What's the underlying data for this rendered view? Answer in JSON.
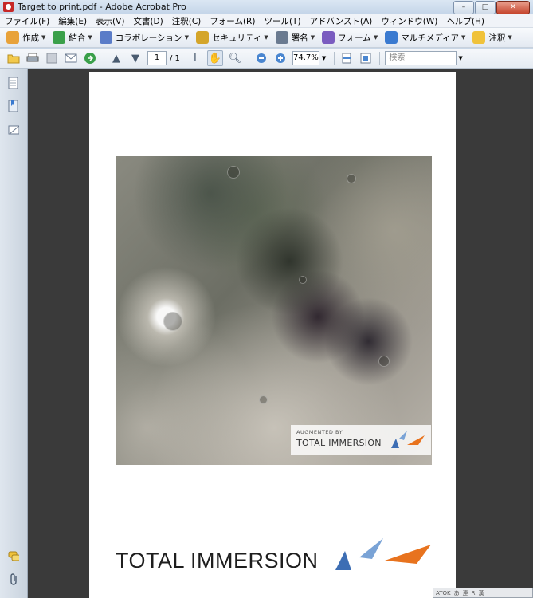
{
  "window": {
    "title": "Target to print.pdf - Adobe Acrobat Pro"
  },
  "menu": [
    "ファイル(F)",
    "編集(E)",
    "表示(V)",
    "文書(D)",
    "注釈(C)",
    "フォーム(R)",
    "ツール(T)",
    "アドバンスト(A)",
    "ウィンドウ(W)",
    "ヘルプ(H)"
  ],
  "tasks": [
    {
      "label": "作成",
      "color": "#e8a23a"
    },
    {
      "label": "結合",
      "color": "#3aa04a"
    },
    {
      "label": "コラボレーション",
      "color": "#5a7cc8"
    },
    {
      "label": "セキュリティ",
      "color": "#d4a52a"
    },
    {
      "label": "署名",
      "color": "#6a7a90"
    },
    {
      "label": "フォーム",
      "color": "#7a5cc0"
    },
    {
      "label": "マルチメディア",
      "color": "#3a7ad0"
    },
    {
      "label": "注釈",
      "color": "#f0c23a"
    }
  ],
  "toolbar": {
    "page_current": "1",
    "page_total": "/ 1",
    "zoom": "74.7%",
    "search_placeholder": "検索"
  },
  "document": {
    "badge_top": "AUGMENTED BY",
    "badge_brand": "TOTAL IMMERSION",
    "logo_text": "TOTAL IMMERSION",
    "brand_colors": {
      "blue": "#3d6eb4",
      "light_blue": "#7aa3d6",
      "orange": "#e8731e"
    }
  },
  "ime": {
    "labels": [
      "ATOK",
      "あ",
      "連",
      "R",
      "漢"
    ]
  }
}
